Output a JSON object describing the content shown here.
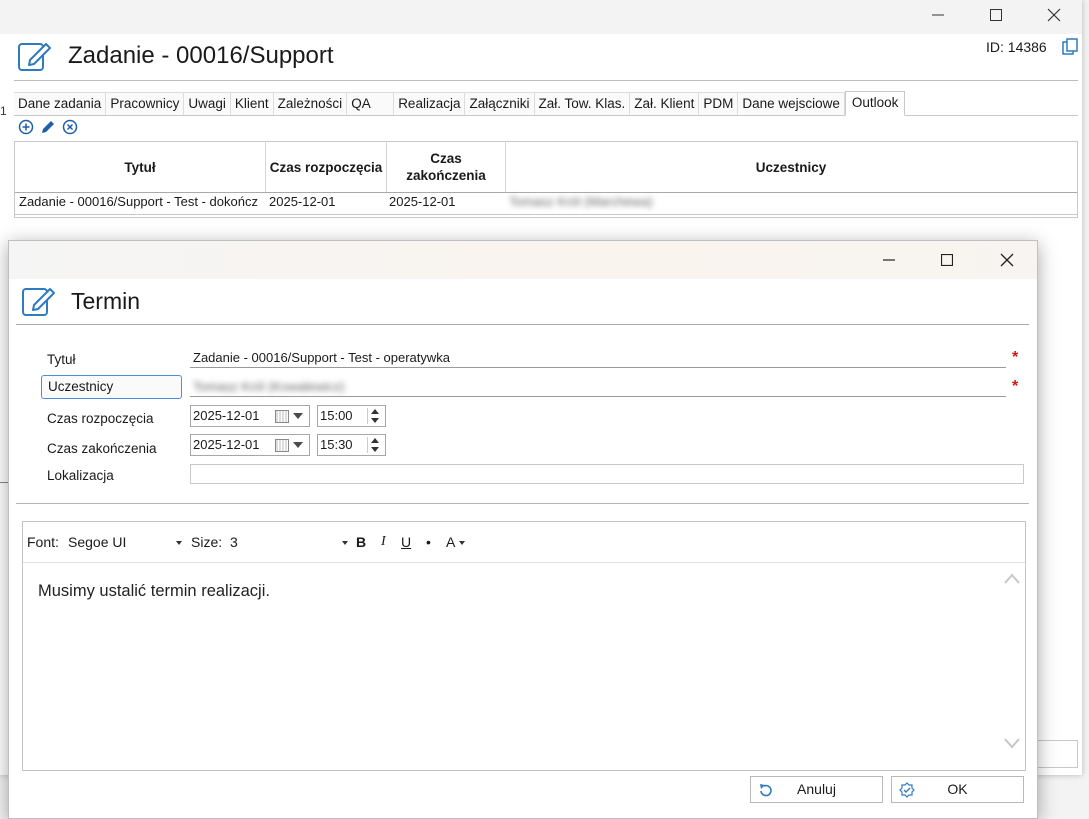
{
  "main_window": {
    "title": "Zadanie - 00016/Support",
    "id_label": "ID: 14386",
    "left_marker": "1",
    "tabs": [
      {
        "label": "Dane zadania"
      },
      {
        "label": "Pracownicy"
      },
      {
        "label": "Uwagi"
      },
      {
        "label": "Klient"
      },
      {
        "label": "Zależności"
      },
      {
        "label": "QA"
      },
      {
        "label": "Realizacja"
      },
      {
        "label": "Załączniki"
      },
      {
        "label": "Zał. Tow. Klas."
      },
      {
        "label": "Zał. Klient"
      },
      {
        "label": "PDM"
      },
      {
        "label": "Dane wejsciowe"
      },
      {
        "label": "Outlook"
      }
    ],
    "active_tab": "Outlook",
    "toolbar_icons": [
      "add-circle-icon",
      "pencil-icon",
      "delete-circle-icon"
    ],
    "grid": {
      "columns": [
        "Tytuł",
        "Czas rozpoczęcia",
        "Czas\nzakończenia",
        "Uczestnicy"
      ],
      "rows": [
        {
          "title": "Zadanie - 00016/Support - Test - dokończ",
          "start": "2025-12-01",
          "end": "2025-12-01",
          "participants": "Tomasz Król (Marchewa)"
        }
      ]
    }
  },
  "dialog": {
    "title": "Termin",
    "fields": {
      "title_label": "Tytuł",
      "title_value": "Zadanie - 00016/Support - Test - operatywka",
      "participants_button": "Uczestnicy",
      "participants_value": "Tomasz Król (Kowalewicz)",
      "start_label": "Czas rozpoczęcia",
      "start_date": "2025-12-01",
      "start_time": "15:00",
      "end_label": "Czas zakończenia",
      "end_date": "2025-12-01",
      "end_time": "15:30",
      "location_label": "Lokalizacja",
      "location_value": "",
      "required_mark": "*"
    },
    "editor": {
      "font_label": "Font:",
      "font_value": "Segoe UI",
      "size_label": "Size:",
      "size_value": "3",
      "bold": "B",
      "italic": "I",
      "underline": "U",
      "bullet": "•",
      "color": "A",
      "content": "Musimy ustalić termin realizacji."
    },
    "buttons": {
      "cancel": "Anuluj",
      "ok": "OK"
    }
  }
}
